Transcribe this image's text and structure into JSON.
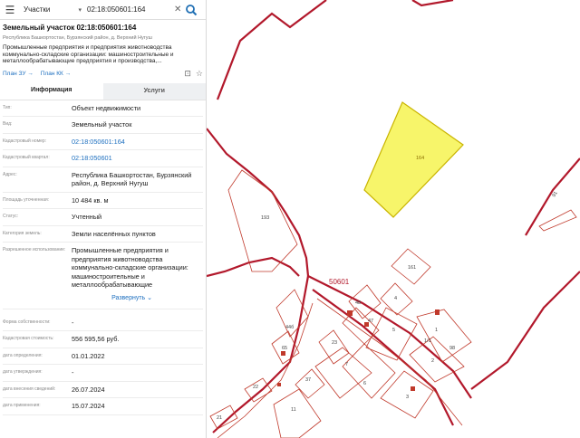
{
  "search": {
    "category": "Участки",
    "query": "02:18:050601:164"
  },
  "parcel": {
    "title": "Земельный участок 02:18:050601:164",
    "address": "Республика Башкортостан, Бурзянский район, д. Верхний Нугуш",
    "use_short": "Промышленные предприятия и предприятия животноводства коммунально-складские организации: машиностроительные и металлообрабатывающие предприятия и производства,...",
    "links": {
      "plan_zu": "План ЗУ →",
      "plan_kk": "План КК →"
    }
  },
  "tabs": {
    "info": "Информация",
    "services": "Услуги"
  },
  "rows": [
    {
      "label": "Тип:",
      "value": "Объект недвижимости"
    },
    {
      "label": "Вид:",
      "value": "Земельный участок"
    },
    {
      "label": "Кадастровый номер:",
      "value": "02:18:050601:164",
      "link": true
    },
    {
      "label": "Кадастровый квартал:",
      "value": "02:18:050601",
      "link": true
    },
    {
      "label": "Адрес:",
      "value": "Республика Башкортостан, Бурзянский район, д. Верхний Нугуш"
    },
    {
      "label": "Площадь уточненная:",
      "value": "10 484 кв. м"
    },
    {
      "label": "Статус:",
      "value": "Учтенный"
    },
    {
      "label": "Категория земель:",
      "value": "Земли населённых пунктов"
    },
    {
      "label": "Разрешенное использование:",
      "value": "Промышленные предприятия и предприятия животноводства коммунально-складские организации: машиностроительные и металлообрабатывающие"
    }
  ],
  "expand_label": "Развернуть ⌄",
  "rows2": [
    {
      "label": "Форма собственности:",
      "value": "-"
    },
    {
      "label": "Кадастровая стоимость:",
      "value": "556 595,56 руб."
    },
    {
      "label": "дата определения:",
      "value": "01.01.2022"
    },
    {
      "label": "дата утверждения:",
      "value": "-"
    },
    {
      "label": "дата внесения сведений:",
      "value": "26.07.2024"
    },
    {
      "label": "дата применения:",
      "value": "15.07.2024"
    }
  ],
  "map": {
    "quarter_label": "50601",
    "selected_label": "164",
    "parcel_labels": [
      "193",
      "161",
      "48",
      "4",
      "47",
      "5",
      "1",
      "2",
      "3",
      "6",
      "7",
      "23",
      "37",
      "11",
      "21",
      "22",
      "44б",
      "65",
      "91",
      "1/1",
      "98"
    ],
    "colors": {
      "boundary": "#b2182b",
      "parcel": "#c0392b",
      "selected_fill": "#f7f56a",
      "selected_stroke": "#c9b400"
    }
  }
}
